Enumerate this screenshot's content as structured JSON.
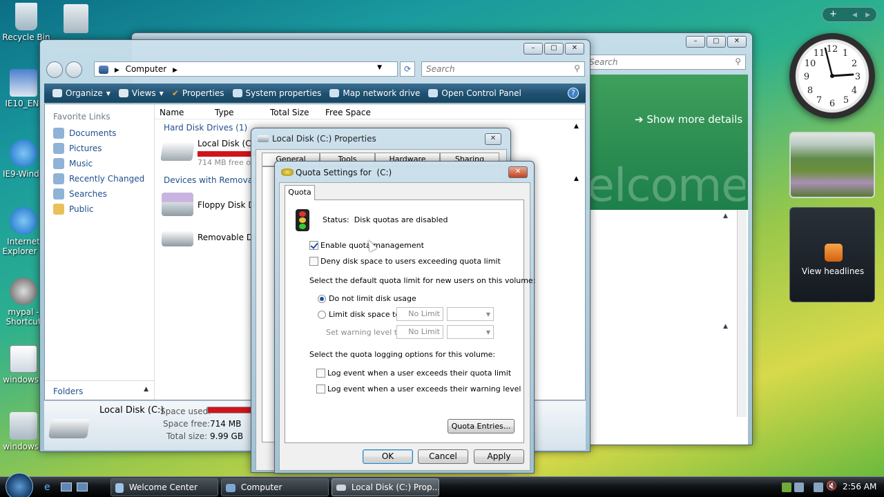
{
  "desktop": {
    "icons": [
      {
        "label": "Recycle Bin"
      },
      {
        "label": "IE10_EN-"
      },
      {
        "label": "IE9-Windo"
      },
      {
        "label": "Internet Explorer T"
      },
      {
        "label": "mypal - Shortcut"
      },
      {
        "label": "windows6"
      },
      {
        "label": "windows6"
      }
    ]
  },
  "welcome_window": {
    "search_placeholder": "Search",
    "show_more": "Show more details",
    "banner_text": "Welcome"
  },
  "explorer": {
    "address": "Computer",
    "search_placeholder": "Search",
    "commands": [
      "Organize",
      "Views",
      "Properties",
      "System properties",
      "Map network drive",
      "Open Control Panel"
    ],
    "favorite_links_title": "Favorite Links",
    "links": [
      "Documents",
      "Pictures",
      "Music",
      "Recently Changed",
      "Searches",
      "Public"
    ],
    "folders_label": "Folders",
    "columns": [
      "Name",
      "Type",
      "Total Size",
      "Free Space"
    ],
    "group_hdd": "Hard Disk Drives (1)",
    "group_removable": "Devices with Removable",
    "items": [
      {
        "name": "Local Disk (C:)",
        "sub": "714 MB free of"
      },
      {
        "name": "Floppy Disk Dri"
      },
      {
        "name": "Removable Dis"
      }
    ],
    "details": {
      "name": "Local Disk (C:)",
      "space_used_label": "Space used:",
      "space_free_label": "Space free:",
      "space_free": "714 MB",
      "total_size_label": "Total size:",
      "total_size": "9.99 GB",
      "used_fraction": 0.93
    }
  },
  "properties_dialog": {
    "title": "Local Disk (C:) Properties",
    "tabs": [
      "General",
      "Tools",
      "Hardware",
      "Sharing"
    ]
  },
  "quota_dialog": {
    "title": "Quota Settings for  (C:)",
    "tab": "Quota",
    "status": "Status:  Disk quotas are disabled",
    "enable": "Enable quota management",
    "deny": "Deny disk space to users exceeding quota limit",
    "default_label": "Select the default quota limit for new users on this volume:",
    "no_limit": "Do not limit disk usage",
    "limit": "Limit disk space to",
    "warning": "Set warning level to",
    "limit_value": "No Limit",
    "warning_value": "No Limit",
    "logging_label": "Select the quota logging options for this volume:",
    "log_limit": "Log event when a user exceeds their quota limit",
    "log_warning": "Log event when a user exceeds their warning level",
    "entries_btn": "Quota Entries...",
    "ok": "OK",
    "cancel": "Cancel",
    "apply": "Apply"
  },
  "sidebar": {
    "headlines": "View headlines"
  },
  "taskbar": {
    "tasks": [
      "Welcome Center",
      "Computer",
      "Local Disk (C:) Prop..."
    ],
    "time": "2:56 AM"
  },
  "colors": {
    "accent": "#1e4e8c",
    "used_bar": "#d0141c"
  }
}
